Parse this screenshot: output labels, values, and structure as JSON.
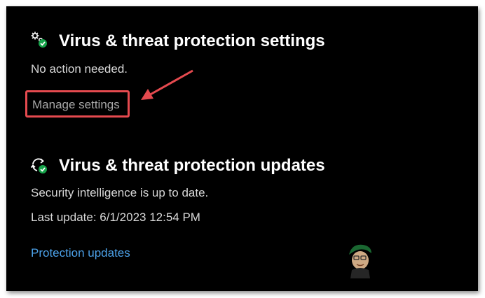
{
  "settings_section": {
    "title": "Virus & threat protection settings",
    "status": "No action needed.",
    "manage_link": "Manage settings",
    "icon": "gear-check-icon"
  },
  "updates_section": {
    "title": "Virus & threat protection updates",
    "status": "Security intelligence is up to date.",
    "last_update": "Last update: 6/1/2023 12:54 PM",
    "updates_link": "Protection updates",
    "icon": "refresh-check-icon"
  },
  "colors": {
    "background": "#000000",
    "link": "#4ca1e8",
    "highlight": "#e54a4f",
    "check_green": "#16a34a"
  },
  "annotations": {
    "highlight_box": "red-rectangle",
    "pointer": "red-arrow"
  }
}
